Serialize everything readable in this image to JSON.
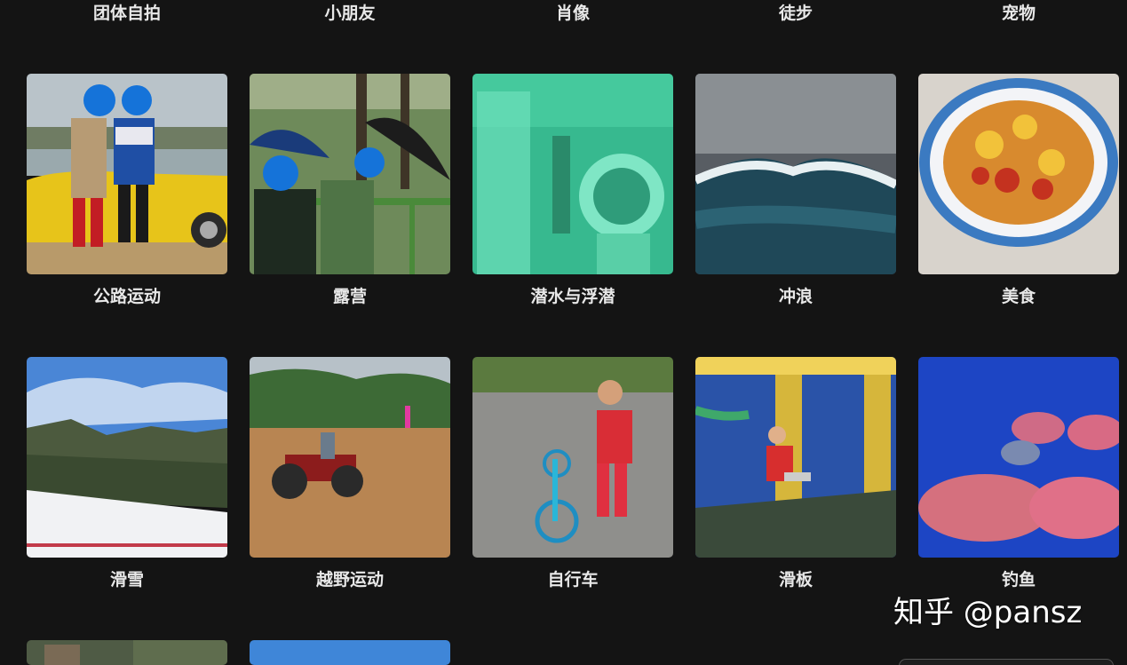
{
  "rows": [
    {
      "labels": [
        "团体自拍",
        "小朋友",
        "肖像",
        "徒步",
        "宠物"
      ]
    },
    {
      "labels": [
        "公路运动",
        "露营",
        "潜水与浮潜",
        "冲浪",
        "美食"
      ]
    },
    {
      "labels": [
        "滑雪",
        "越野运动",
        "自行车",
        "滑板",
        "钓鱼"
      ]
    }
  ],
  "watermark": "知乎 @pansz"
}
